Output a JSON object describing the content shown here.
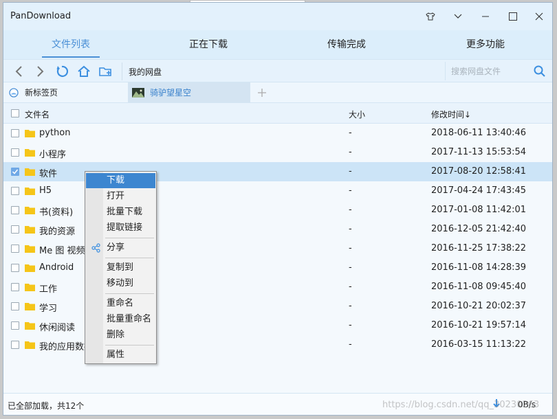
{
  "window": {
    "title": "PanDownload"
  },
  "tabs": [
    {
      "label": "文件列表",
      "active": true
    },
    {
      "label": "正在下载",
      "active": false
    },
    {
      "label": "传输完成",
      "active": false
    },
    {
      "label": "更多功能",
      "active": false
    }
  ],
  "toolbar": {
    "path": "我的网盘",
    "search_placeholder": "搜索网盘文件"
  },
  "page_tabs": [
    {
      "label": "新标签页"
    },
    {
      "label": "骑驴望星空"
    }
  ],
  "columns": {
    "name": "文件名",
    "size": "大小",
    "modified": "修改时间↓"
  },
  "files": [
    {
      "name": "python",
      "size": "-",
      "date": "2018-06-11 13:40:46",
      "checked": false
    },
    {
      "name": "小程序",
      "size": "-",
      "date": "2017-11-13 15:53:54",
      "checked": false
    },
    {
      "name": "软件",
      "size": "-",
      "date": "2017-08-20 12:58:41",
      "checked": true
    },
    {
      "name": "H5",
      "size": "-",
      "date": "2017-04-24 17:43:45",
      "checked": false
    },
    {
      "name": "书(资料)",
      "size": "-",
      "date": "2017-01-08 11:42:01",
      "checked": false
    },
    {
      "name": "我的资源",
      "size": "-",
      "date": "2016-12-05 21:42:40",
      "checked": false
    },
    {
      "name": "Me 图 视频",
      "size": "-",
      "date": "2016-11-25 17:38:22",
      "checked": false
    },
    {
      "name": "Android",
      "size": "-",
      "date": "2016-11-08 14:28:39",
      "checked": false
    },
    {
      "name": "工作",
      "size": "-",
      "date": "2016-11-08 09:45:40",
      "checked": false
    },
    {
      "name": "学习",
      "size": "-",
      "date": "2016-10-21 20:02:37",
      "checked": false
    },
    {
      "name": "休闲阅读",
      "size": "-",
      "date": "2016-10-21 19:57:14",
      "checked": false
    },
    {
      "name": "我的应用数据",
      "size": "-",
      "date": "2016-03-15 11:13:22",
      "checked": false
    }
  ],
  "context_menu": {
    "items": [
      "下载",
      "打开",
      "批量下载",
      "提取链接",
      "分享",
      "复制到",
      "移动到",
      "重命名",
      "批量重命名",
      "删除",
      "属性"
    ],
    "highlighted": "下载"
  },
  "status": {
    "text": "已全部加载，共12个",
    "speed": "0B/s"
  },
  "watermark": "https://blog.csdn.net/qq_30230263",
  "colors": {
    "accent": "#4a8fd6",
    "selected_row": "#cce4f7",
    "folder": "#f5c518",
    "menu_highlight": "#3d86d0"
  }
}
